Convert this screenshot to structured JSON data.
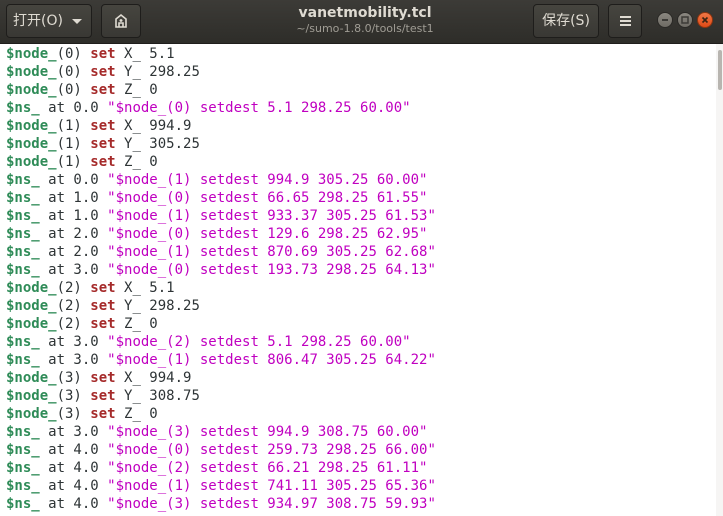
{
  "titlebar": {
    "open_label": "打开(O)",
    "save_label": "保存(S)",
    "file_name": "vanetmobility.tcl",
    "file_path": "~/sumo-1.8.0/tools/test1"
  },
  "editor": {
    "lines": [
      [
        "$node_",
        "(0) ",
        "set",
        " X_ 5.1",
        ""
      ],
      [
        "$node_",
        "(0) ",
        "set",
        " Y_ 298.25",
        ""
      ],
      [
        "$node_",
        "(0) ",
        "set",
        " Z_ 0",
        ""
      ],
      [
        "$ns_",
        " at 0.0 ",
        "",
        "",
        "\"$node_(0) setdest 5.1 298.25 60.00\""
      ],
      [
        "$node_",
        "(1) ",
        "set",
        " X_ 994.9",
        ""
      ],
      [
        "$node_",
        "(1) ",
        "set",
        " Y_ 305.25",
        ""
      ],
      [
        "$node_",
        "(1) ",
        "set",
        " Z_ 0",
        ""
      ],
      [
        "$ns_",
        " at 0.0 ",
        "",
        "",
        "\"$node_(1) setdest 994.9 305.25 60.00\""
      ],
      [
        "$ns_",
        " at 1.0 ",
        "",
        "",
        "\"$node_(0) setdest 66.65 298.25 61.55\""
      ],
      [
        "$ns_",
        " at 1.0 ",
        "",
        "",
        "\"$node_(1) setdest 933.37 305.25 61.53\""
      ],
      [
        "$ns_",
        " at 2.0 ",
        "",
        "",
        "\"$node_(0) setdest 129.6 298.25 62.95\""
      ],
      [
        "$ns_",
        " at 2.0 ",
        "",
        "",
        "\"$node_(1) setdest 870.69 305.25 62.68\""
      ],
      [
        "$ns_",
        " at 3.0 ",
        "",
        "",
        "\"$node_(0) setdest 193.73 298.25 64.13\""
      ],
      [
        "$node_",
        "(2) ",
        "set",
        " X_ 5.1",
        ""
      ],
      [
        "$node_",
        "(2) ",
        "set",
        " Y_ 298.25",
        ""
      ],
      [
        "$node_",
        "(2) ",
        "set",
        " Z_ 0",
        ""
      ],
      [
        "$ns_",
        " at 3.0 ",
        "",
        "",
        "\"$node_(2) setdest 5.1 298.25 60.00\""
      ],
      [
        "$ns_",
        " at 3.0 ",
        "",
        "",
        "\"$node_(1) setdest 806.47 305.25 64.22\""
      ],
      [
        "$node_",
        "(3) ",
        "set",
        " X_ 994.9",
        ""
      ],
      [
        "$node_",
        "(3) ",
        "set",
        " Y_ 308.75",
        ""
      ],
      [
        "$node_",
        "(3) ",
        "set",
        " Z_ 0",
        ""
      ],
      [
        "$ns_",
        " at 3.0 ",
        "",
        "",
        "\"$node_(3) setdest 994.9 308.75 60.00\""
      ],
      [
        "$ns_",
        " at 4.0 ",
        "",
        "",
        "\"$node_(0) setdest 259.73 298.25 66.00\""
      ],
      [
        "$ns_",
        " at 4.0 ",
        "",
        "",
        "\"$node_(2) setdest 66.21 298.25 61.11\""
      ],
      [
        "$ns_",
        " at 4.0 ",
        "",
        "",
        "\"$node_(1) setdest 741.11 305.25 65.36\""
      ],
      [
        "$ns_",
        " at 4.0 ",
        "",
        "",
        "\"$node_(3) setdest 934.97 308.75 59.93\""
      ]
    ]
  },
  "icons": {
    "open_caret": "chevron-down-icon",
    "new_document": "new-document-icon",
    "menu": "hamburger-menu-icon",
    "minimize": "minimize-icon",
    "maximize": "maximize-icon",
    "close": "close-icon"
  },
  "colors": {
    "titlebar_bg": "#3c3b37",
    "variable": "#2e8b57",
    "keyword": "#a52a2a",
    "string": "#c000c0",
    "text": "#2e3436",
    "close_button": "#df4a16"
  }
}
